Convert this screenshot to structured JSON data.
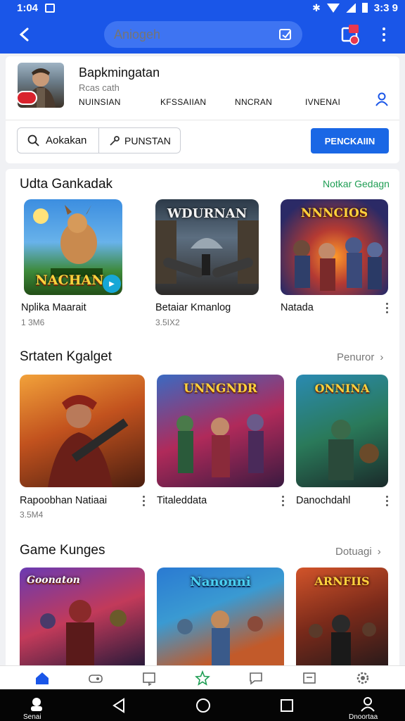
{
  "status": {
    "time": "1:04",
    "right_text": "3:3 9"
  },
  "search": {
    "placeholder": "Aniogeh"
  },
  "app": {
    "title": "Bapkmingatan",
    "subtitle": "Rcas cath",
    "tabs": [
      "NUINSIAN",
      "KFSSAIIAN",
      "NNCRAN",
      "IVNENAI"
    ],
    "search_label": "Aokakan",
    "punstan_label": "PUNSTAN",
    "install_label": "PENCKAIIN"
  },
  "sections": [
    {
      "title": "Udta Gankadak",
      "link": "Notkar Gedagn",
      "items": [
        {
          "name": "Nplika Maarait",
          "meta": "1 3M6",
          "tile_text": "NACHAN"
        },
        {
          "name": "Betaiar Kmanlog",
          "meta": "3.5IX2",
          "tile_text": "WDURNAN"
        },
        {
          "name": "Natada",
          "meta": "",
          "tile_text": "NNNCIOS"
        }
      ]
    },
    {
      "title": "Srtaten Kgalget",
      "link": "Penuror",
      "items": [
        {
          "name": "Rapoobhan Natiaai",
          "meta": "3.5M4",
          "tile_text": ""
        },
        {
          "name": "Titaleddata",
          "meta": "",
          "tile_text": "UNNGNDR"
        },
        {
          "name": "Danochdahl",
          "meta": "",
          "tile_text": "ONNINA"
        }
      ]
    },
    {
      "title": "Game Kunges",
      "link": "Dotuagi",
      "items": [
        {
          "name": "",
          "meta": "",
          "tile_text": "Goonaton"
        },
        {
          "name": "",
          "meta": "",
          "tile_text": "Nanonni"
        },
        {
          "name": "",
          "meta": "",
          "tile_text": "ARNFIIS"
        }
      ]
    }
  ],
  "nav": {
    "home_label": "Senai",
    "profile_label": "Dnoortaa"
  },
  "colors": {
    "accent": "#1a56e8",
    "install": "#1a67e5",
    "link_green": "#1f9e54"
  }
}
